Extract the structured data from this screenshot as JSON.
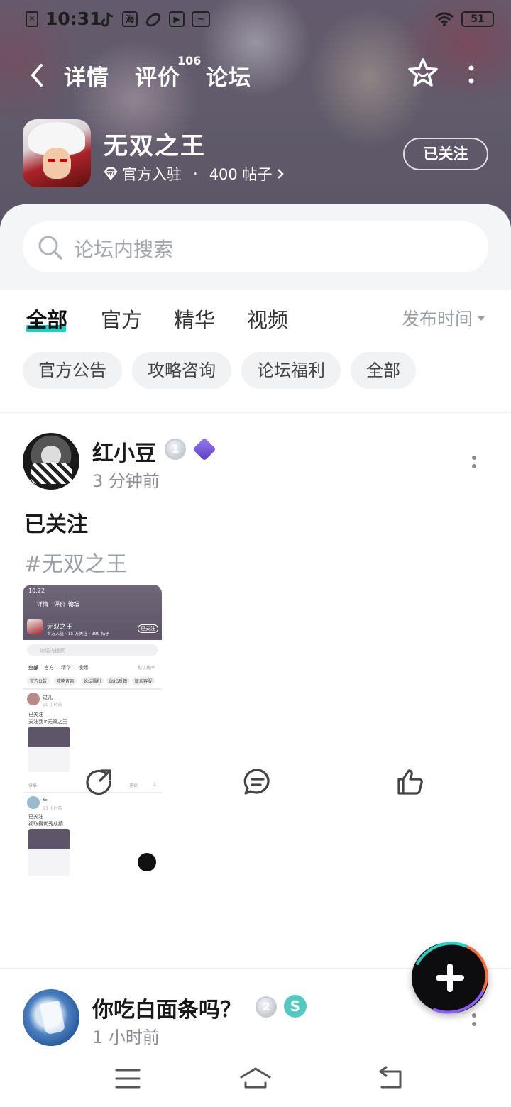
{
  "status_bar": {
    "time": "10:31",
    "battery": "51",
    "icons": [
      "sim-icon",
      "tiktok-icon",
      "app-icon",
      "link-icon",
      "play-icon",
      "pulse-icon",
      "wifi-icon",
      "battery-icon"
    ]
  },
  "nav": {
    "tabs": [
      {
        "label": "详情"
      },
      {
        "label": "评价"
      },
      {
        "label": "论坛"
      }
    ],
    "review_count": "106",
    "active_tab": "论坛"
  },
  "game": {
    "title": "无双之王",
    "official_label": "官方入驻",
    "separator": "·",
    "posts": "400 帖子",
    "follow_label": "已关注"
  },
  "search": {
    "placeholder": "论坛内搜索"
  },
  "filters": {
    "tabs": [
      "全部",
      "官方",
      "精华",
      "视频"
    ],
    "sort_label": "发布时间",
    "chips": [
      "官方公告",
      "攻略咨询",
      "论坛福利",
      "全部"
    ]
  },
  "posts": [
    {
      "author": "红小豆",
      "level": "1",
      "time": "3 分钟前",
      "title": "已关注",
      "tag": "#无双之王",
      "screenshot": {
        "time": "10:22",
        "nav": [
          "详情",
          "评价",
          "论坛"
        ],
        "game": "无双之王",
        "meta": "官方入驻 · 15 万关注 · 399 帖子",
        "follow": "已关注",
        "search": "论坛内搜索",
        "tabs": [
          "全部",
          "官方",
          "精华",
          "视频"
        ],
        "sort": "默认排序",
        "chips": [
          "官方公告",
          "攻略咨询",
          "论坛福利",
          "BUG反馈",
          "联系客服"
        ],
        "p1_user": "过儿",
        "p1_time": "11 小时前",
        "p1_title": "已关注",
        "p1_body": "关注我#无双之王",
        "p1_share": "分享",
        "p1_comment": "评论",
        "p1_like": "1",
        "p2_user": "生",
        "p2_time": "13 小时前",
        "p2_title": "已关注",
        "p2_body": "视取得优秀成绩"
      }
    },
    {
      "author": "你吃白面条吗？",
      "level": "2",
      "time": "1 小时前"
    }
  ],
  "colors": {
    "accent": "#16d1c4",
    "hero_bg": "#6a6474",
    "chip_bg": "#f1f2f4",
    "muted_text": "#8b8f95"
  }
}
